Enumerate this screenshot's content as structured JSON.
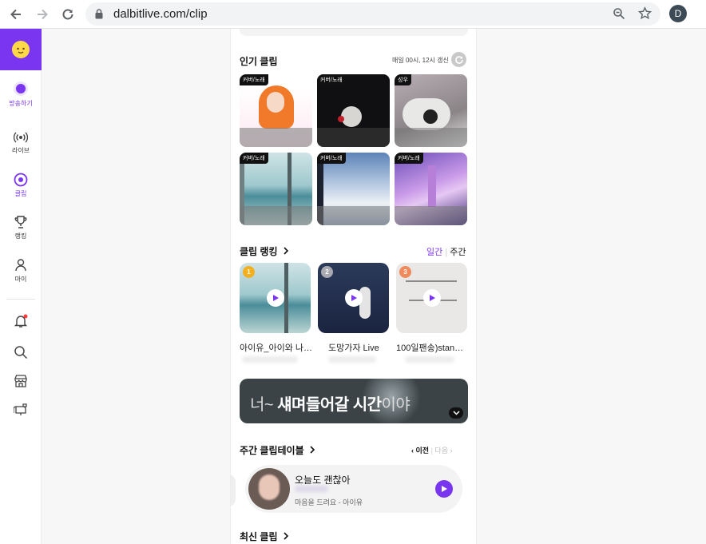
{
  "browser": {
    "url": "dalbitlive.com/clip",
    "profile_initial": "D"
  },
  "sidebar": {
    "items": [
      {
        "label": "방송하기"
      },
      {
        "label": "라이브"
      },
      {
        "label": "클립"
      },
      {
        "label": "랭킹"
      },
      {
        "label": "마이"
      }
    ]
  },
  "popular": {
    "title": "인기 클립",
    "refresh_note": "매일 00시, 12시 갱신",
    "clips": [
      {
        "tag": "커버/노래"
      },
      {
        "tag": "커버/노래"
      },
      {
        "tag": "성우"
      },
      {
        "tag": "커버/노래"
      },
      {
        "tag": "커버/노래"
      },
      {
        "tag": "커버/노래"
      }
    ]
  },
  "ranking": {
    "title": "클립 랭킹",
    "tab_daily": "일간",
    "tab_weekly": "주간",
    "items": [
      {
        "rank": "1",
        "title": "아이유_아이와 나…"
      },
      {
        "rank": "2",
        "title": "도망가자 Live"
      },
      {
        "rank": "3",
        "title": "100일팬송)stan…"
      }
    ]
  },
  "banner": {
    "text_light_1": "너~ ",
    "text_bold_1": "섀며들어갈 ",
    "text_bold_2": "시간",
    "text_light_2": "이야"
  },
  "weekly": {
    "title": "주간 클립테이블",
    "prev_label": "이전",
    "next_label": "다음",
    "card_title": "오늘도 괜찮아",
    "card_subtitle": "마음을 드려요 - 아이유"
  },
  "latest": {
    "title": "최신 클립"
  },
  "colors": {
    "accent": "#7a35f0",
    "gold": "#f2b01e",
    "silver": "#a9a9b2",
    "bronze": "#f08a5d"
  }
}
